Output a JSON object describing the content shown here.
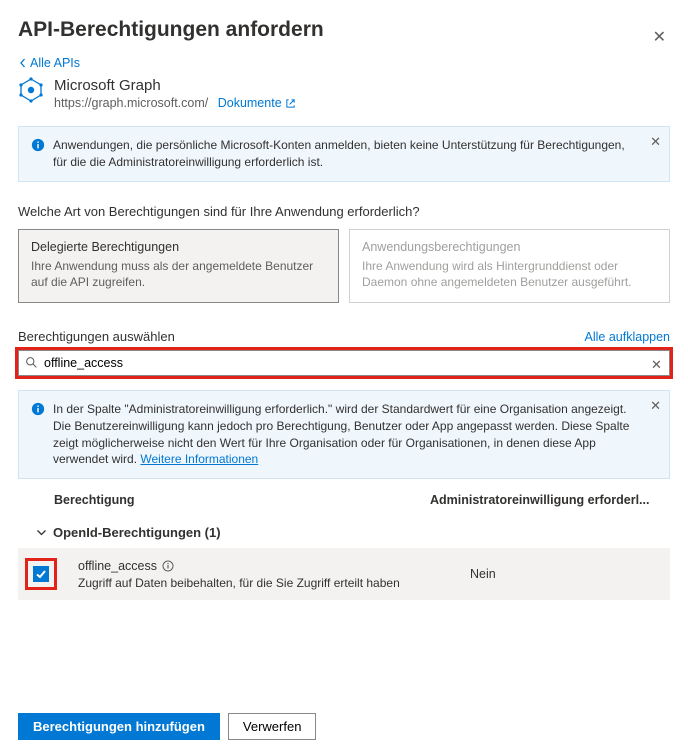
{
  "header": {
    "title": "API-Berechtigungen anfordern",
    "back_label": "Alle APIs"
  },
  "api": {
    "name": "Microsoft Graph",
    "url": "https://graph.microsoft.com/",
    "docs_label": "Dokumente"
  },
  "banner_personal": "Anwendungen, die persönliche Microsoft-Konten anmelden, bieten keine Unterstützung für Berechtigungen, für die die Administratoreinwilligung erforderlich ist.",
  "question": "Welche Art von Berechtigungen sind für Ihre Anwendung erforderlich?",
  "type_cards": {
    "delegated": {
      "title": "Delegierte Berechtigungen",
      "desc": "Ihre Anwendung muss als der angemeldete Benutzer auf die API zugreifen."
    },
    "app": {
      "title": "Anwendungsberechtigungen",
      "desc": "Ihre Anwendung wird als Hintergrunddienst oder Daemon ohne angemeldeten Benutzer ausgeführt."
    }
  },
  "select_section": {
    "label": "Berechtigungen auswählen",
    "expand_all": "Alle aufklappen"
  },
  "search": {
    "value": "offline_access"
  },
  "banner_admin": {
    "text": "In der Spalte \"Administratoreinwilligung erforderlich.\" wird der Standardwert für eine Organisation angezeigt. Die Benutzereinwilligung kann jedoch pro Berechtigung, Benutzer oder App angepasst werden. Diese Spalte zeigt möglicherweise nicht den Wert für Ihre Organisation oder für Organisationen, in denen diese App verwendet wird.",
    "link": "Weitere Informationen"
  },
  "columns": {
    "permission": "Berechtigung",
    "admin": "Administratoreinwilligung erforderl..."
  },
  "group": {
    "label": "OpenId-Berechtigungen (1)"
  },
  "permission": {
    "name": "offline_access",
    "desc": "Zugriff auf Daten beibehalten, für die Sie Zugriff erteilt haben",
    "admin_value": "Nein",
    "checked": true
  },
  "footer": {
    "add": "Berechtigungen hinzufügen",
    "discard": "Verwerfen"
  }
}
